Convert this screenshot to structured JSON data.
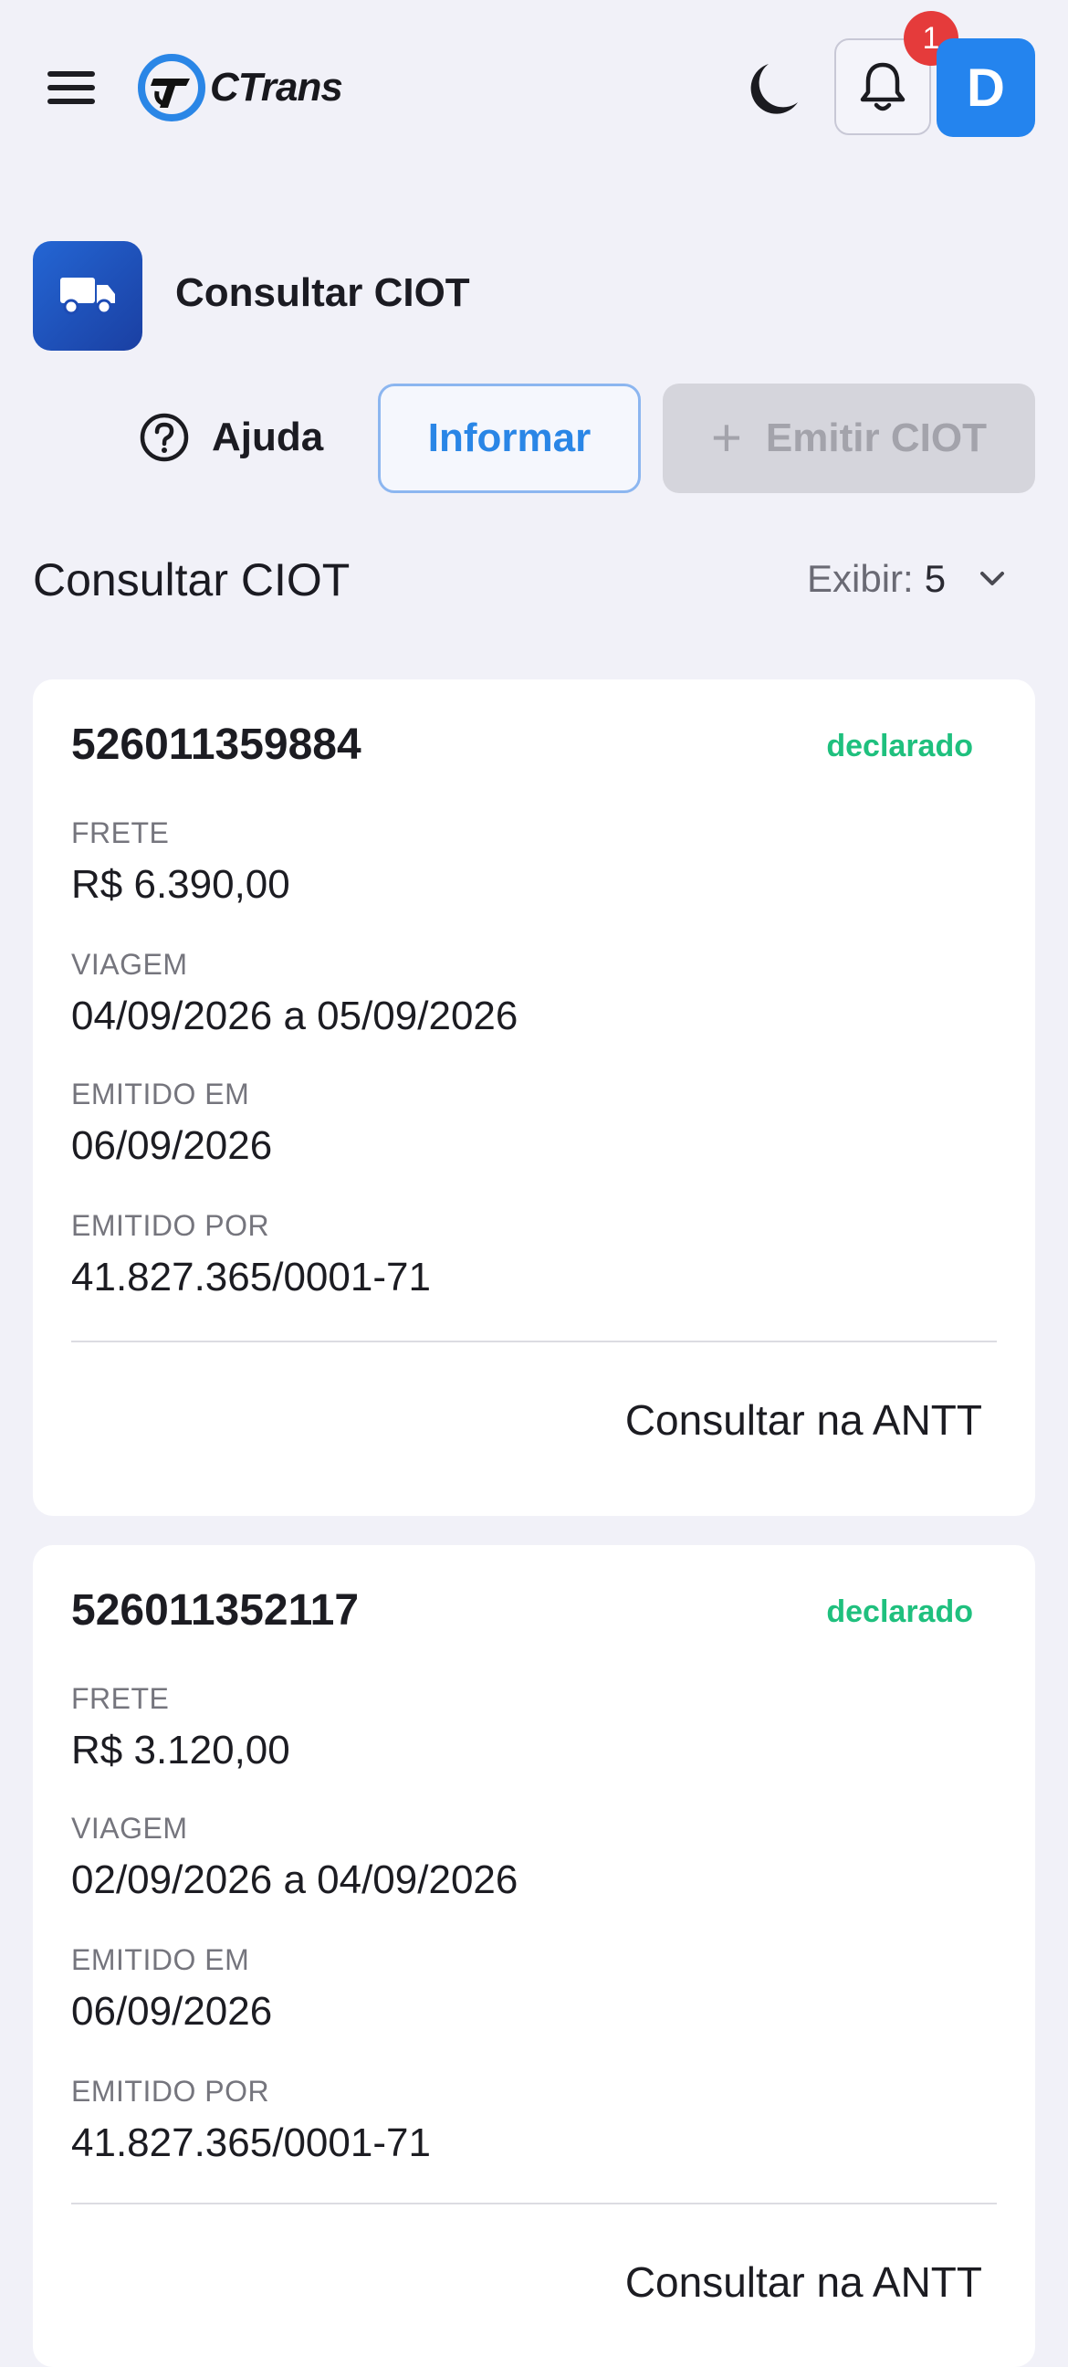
{
  "header": {
    "logo_text": "CTrans",
    "notification_count": "1",
    "avatar_initial": "D"
  },
  "page": {
    "title": "Consultar CIOT"
  },
  "actions": {
    "help_label": "Ajuda",
    "informar_label": "Informar",
    "emitir_label": "Emitir CIOT"
  },
  "list": {
    "title": "Consultar CIOT",
    "show_label": "Exibir:",
    "show_value": "5"
  },
  "labels": {
    "frete": "FRETE",
    "viagem": "VIAGEM",
    "emitido_em": "EMITIDO EM",
    "emitido_por": "EMITIDO POR",
    "consultar": "Consultar na ANTT"
  },
  "cards": [
    {
      "number": "526011359884",
      "status": "declarado",
      "frete": "R$ 6.390,00",
      "viagem": "04/09/2026 a 05/09/2026",
      "emitido_em": "06/09/2026",
      "emitido_por": "41.827.365/0001-71"
    },
    {
      "number": "526011352117",
      "status": "declarado",
      "frete": "R$ 3.120,00",
      "viagem": "02/09/2026 a 04/09/2026",
      "emitido_em": "06/09/2026",
      "emitido_por": "41.827.365/0001-71"
    }
  ],
  "colors": {
    "primary": "#2484ee",
    "status_green": "#1fc07e",
    "badge_red": "#e53b3b",
    "background": "#f1f1f8"
  }
}
